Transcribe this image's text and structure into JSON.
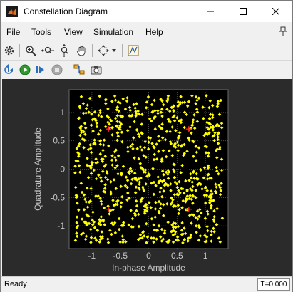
{
  "window": {
    "title": "Constellation Diagram"
  },
  "menu": {
    "items": [
      "File",
      "Tools",
      "View",
      "Simulation",
      "Help"
    ]
  },
  "toolbar1": {
    "icons": [
      "gear-icon",
      "zoom-in-icon",
      "zoom-x-icon",
      "zoom-y-icon",
      "pan-hand-icon",
      "scale-axes-icon",
      "dropdown-arrow-icon",
      "measurement-icon"
    ]
  },
  "toolbar2": {
    "icons": [
      "step-back-icon",
      "run-icon",
      "step-forward-icon",
      "stop-icon",
      "highlight-signal-icon",
      "snapshot-icon"
    ]
  },
  "colors": {
    "background": "#2b2b2b",
    "axes": "#000000",
    "points": "#ffff00",
    "reference": "#ff2020",
    "ticks": "#c8c8c8"
  },
  "chart_data": {
    "type": "scatter",
    "title": "",
    "xlabel": "In-phase Amplitude",
    "ylabel": "Quadrature Amplitude",
    "xlim": [
      -1.4,
      1.4
    ],
    "ylim": [
      -1.4,
      1.4
    ],
    "xticks": [
      "-1",
      "-0.5",
      "0",
      "0.5",
      "1"
    ],
    "yticks": [
      "1",
      "0.5",
      "0",
      "-0.5",
      "-1"
    ],
    "grid": true,
    "series": [
      {
        "kind": "received",
        "count": 820,
        "spread": 1.3
      },
      {
        "kind": "reference",
        "points": [
          [
            -0.707,
            0.707
          ],
          [
            0.707,
            0.707
          ],
          [
            -0.707,
            -0.707
          ],
          [
            0.707,
            -0.707
          ]
        ]
      }
    ]
  },
  "status": {
    "text": "Ready",
    "time": "T=0.000"
  }
}
